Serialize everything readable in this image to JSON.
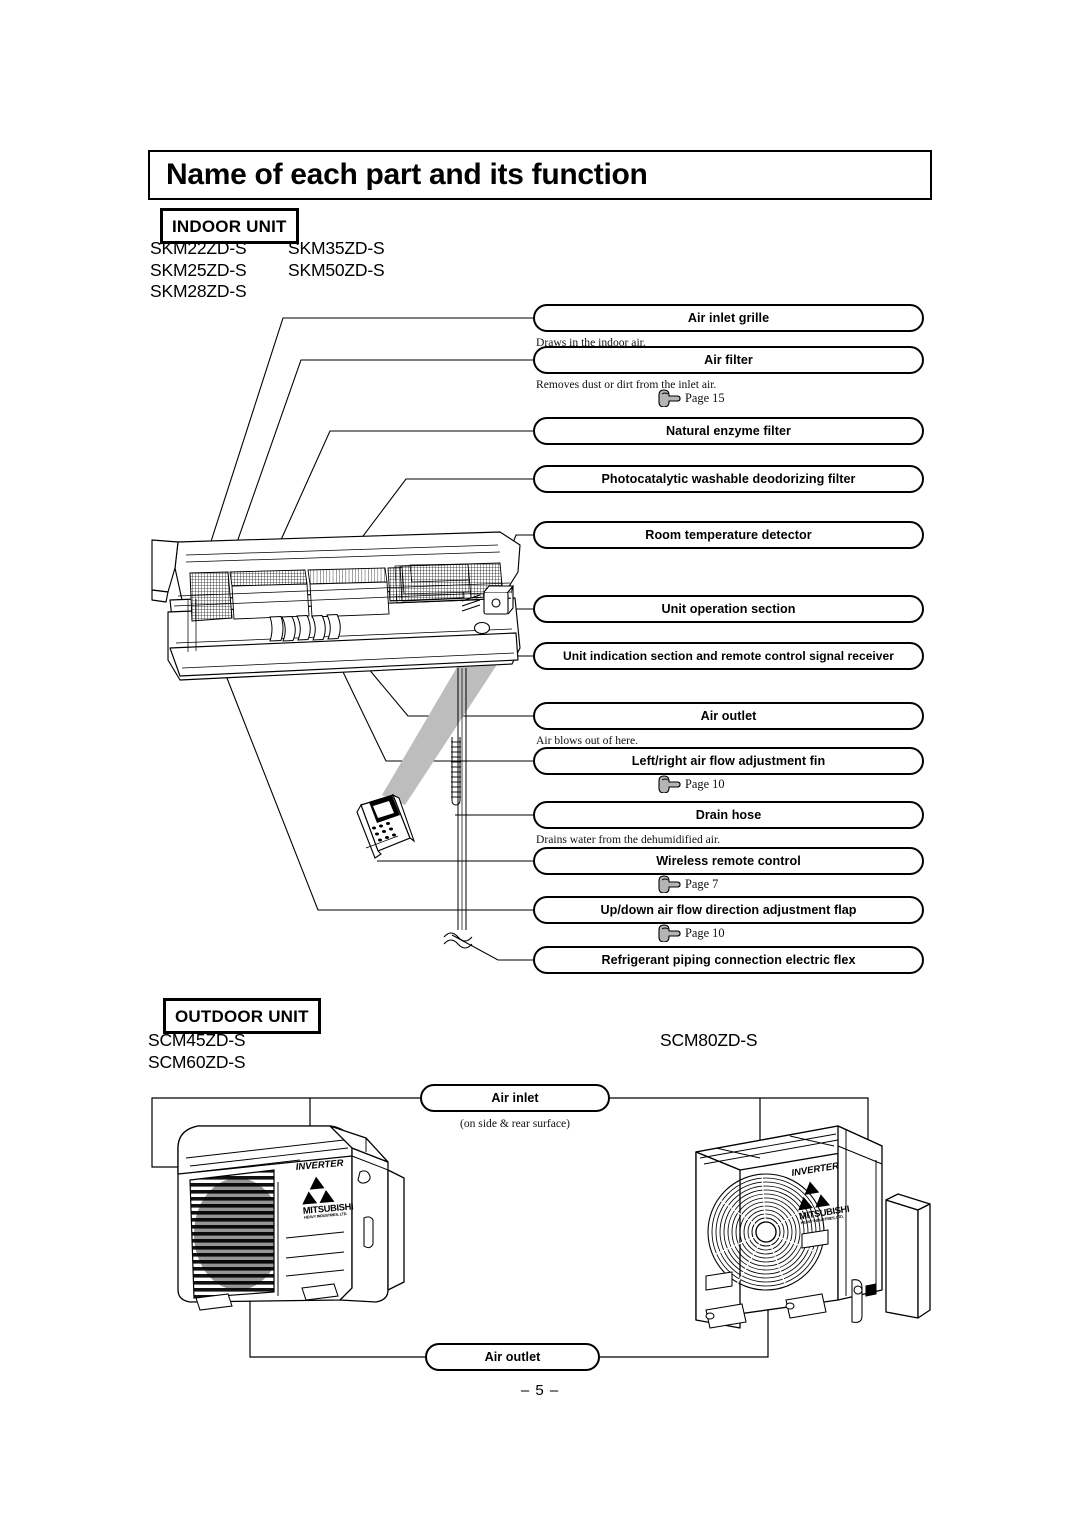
{
  "header": {
    "title": "Name of each part and its function",
    "page_number": "– 5 –"
  },
  "indoor": {
    "section_label": "INDOOR UNIT",
    "models_col1": "SKM22ZD-S\nSKM25ZD-S\nSKM28ZD-S",
    "models_col2": "SKM35ZD-S\nSKM50ZD-S",
    "callouts": [
      {
        "label": "Air inlet grille",
        "desc": "Draws in the indoor air."
      },
      {
        "label": "Air filter",
        "desc": "Removes dust or dirt from the inlet air.",
        "page_ref": "Page 15"
      },
      {
        "label": "Natural enzyme filter"
      },
      {
        "label": "Photocatalytic washable deodorizing filter"
      },
      {
        "label": "Room temperature detector"
      },
      {
        "label": "Unit operation section"
      },
      {
        "label": "Unit indication section and remote control signal receiver"
      },
      {
        "label": "Air outlet",
        "desc": "Air blows out of here."
      },
      {
        "label": "Left/right air flow adjustment fin",
        "page_ref": "Page 10"
      },
      {
        "label": "Drain hose",
        "desc": "Drains water from the dehumidified air."
      },
      {
        "label": "Wireless remote control",
        "page_ref": "Page 7"
      },
      {
        "label": "Up/down air flow direction adjustment flap",
        "page_ref": "Page 10"
      },
      {
        "label": "Refrigerant piping connection electric flex"
      }
    ]
  },
  "outdoor": {
    "section_label": "OUTDOOR UNIT",
    "models_col1": "SCM45ZD-S\nSCM60ZD-S",
    "models_col2": "SCM80ZD-S",
    "callouts": [
      {
        "label": "Air inlet",
        "desc": "(on side & rear surface)"
      },
      {
        "label": "Air outlet"
      }
    ],
    "unit_badges": {
      "inverter": "INVERTER",
      "brand": "MITSUBISHI",
      "brand_sub": "HEAVY INDUSTRIES, LTD."
    }
  },
  "colors": {
    "line": "#000000",
    "hand_fill": "#b5b5b5",
    "beam": "#b8b8b8"
  }
}
